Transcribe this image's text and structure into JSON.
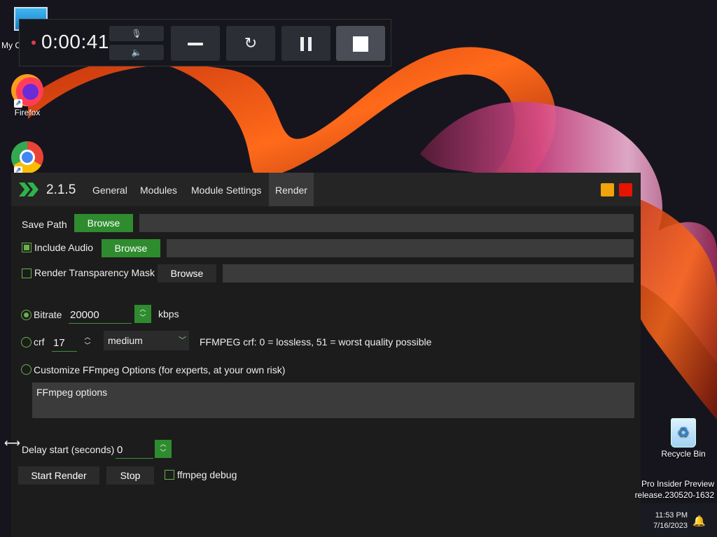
{
  "desktop": {
    "icons": {
      "my_computer": "My C",
      "firefox": "Firefox",
      "recycle_bin": "Recycle Bin"
    },
    "watermark": {
      "line1": "Pro Insider Preview",
      "line2": "release.230520-1632"
    },
    "clock": {
      "time": "11:53 PM",
      "date": "7/16/2023"
    }
  },
  "recorder": {
    "elapsed": "0:00:41",
    "colors": {
      "rec_dot": "#e23b4a",
      "bar_bg": "#16171c"
    }
  },
  "app": {
    "version": "2.1.5",
    "tabs": [
      "General",
      "Modules",
      "Module Settings",
      "Render"
    ],
    "active_tab": "Render",
    "colors": {
      "accent_green": "#2e8b2e",
      "minimize": "#f0a30a",
      "close": "#e51400"
    },
    "render": {
      "save_path_label": "Save Path",
      "browse": "Browse",
      "include_audio_label": "Include Audio",
      "include_audio_checked": true,
      "transparency_label": "Render Transparency Mask",
      "transparency_checked": false,
      "bitrate_label": "Bitrate",
      "bitrate_value": "20000",
      "bitrate_unit": "kbps",
      "bitrate_selected": true,
      "crf_label": "crf",
      "crf_value": "17",
      "preset_value": "medium",
      "crf_hint": "FFMPEG crf: 0 = lossless, 51 = worst quality possible",
      "custom_label": "Customize FFmpeg Options (for experts, at your own risk)",
      "custom_placeholder": "FFmpeg options",
      "delay_label": "Delay start (seconds)",
      "delay_value": "0",
      "start_button": "Start Render",
      "stop_button": "Stop",
      "debug_label": "ffmpeg debug",
      "debug_checked": false
    }
  }
}
